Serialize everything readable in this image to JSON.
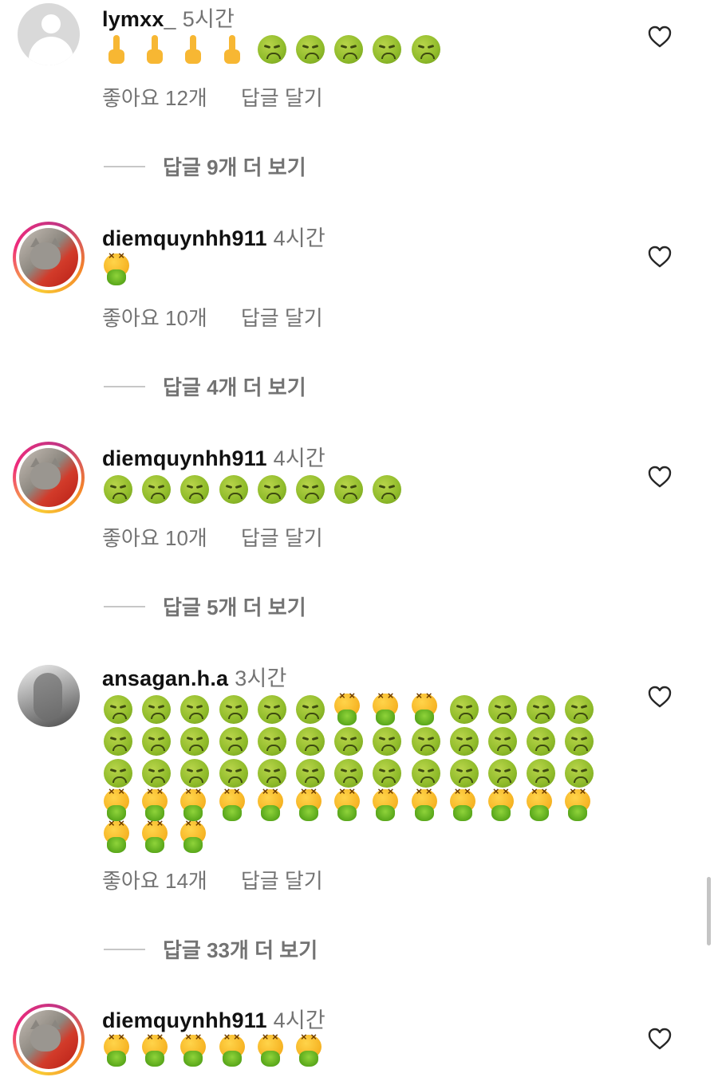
{
  "comments": [
    {
      "username": "lymxx_",
      "time": "5시간",
      "avatar": "default-avatar",
      "emoji_rows": [
        [
          "middle-finger",
          "middle-finger",
          "middle-finger",
          "middle-finger",
          "nauseated",
          "nauseated",
          "nauseated",
          "nauseated",
          "nauseated"
        ]
      ],
      "likes": "좋아요 12개",
      "reply": "답글 달기",
      "view_replies": "답글 9개 더 보기"
    },
    {
      "username": "diemquynhh911",
      "time": "4시간",
      "avatar": "cat-avatar",
      "emoji_rows": [
        [
          "vomiting"
        ]
      ],
      "likes": "좋아요 10개",
      "reply": "답글 달기",
      "view_replies": "답글 4개 더 보기"
    },
    {
      "username": "diemquynhh911",
      "time": "4시간",
      "avatar": "cat-avatar",
      "emoji_rows": [
        [
          "nauseated",
          "nauseated",
          "nauseated",
          "nauseated",
          "nauseated",
          "nauseated",
          "nauseated",
          "nauseated"
        ]
      ],
      "likes": "좋아요 10개",
      "reply": "답글 달기",
      "view_replies": "답글 5개 더 보기"
    },
    {
      "username": "ansagan.h.a",
      "time": "3시간",
      "avatar": "gray-avatar",
      "emoji_rows": [
        [
          "nauseated",
          "nauseated",
          "nauseated",
          "nauseated",
          "nauseated",
          "nauseated",
          "vomiting",
          "vomiting",
          "vomiting",
          "nauseated",
          "nauseated",
          "nauseated",
          "nauseated"
        ],
        [
          "nauseated",
          "nauseated",
          "nauseated",
          "nauseated",
          "nauseated",
          "nauseated",
          "nauseated",
          "nauseated",
          "nauseated",
          "nauseated",
          "nauseated",
          "nauseated",
          "nauseated"
        ],
        [
          "nauseated",
          "nauseated",
          "nauseated",
          "nauseated",
          "nauseated",
          "nauseated",
          "nauseated",
          "nauseated",
          "nauseated",
          "nauseated",
          "nauseated",
          "nauseated",
          "nauseated"
        ],
        [
          "vomiting",
          "vomiting",
          "vomiting",
          "vomiting",
          "vomiting",
          "vomiting",
          "vomiting",
          "vomiting",
          "vomiting",
          "vomiting",
          "vomiting",
          "vomiting",
          "vomiting"
        ],
        [
          "vomiting",
          "vomiting",
          "vomiting"
        ]
      ],
      "likes": "좋아요 14개",
      "reply": "답글 달기",
      "view_replies": "답글 33개 더 보기"
    },
    {
      "username": "diemquynhh911",
      "time": "4시간",
      "avatar": "cat-avatar",
      "emoji_rows": [
        [
          "vomiting",
          "vomiting",
          "vomiting",
          "vomiting",
          "vomiting",
          "vomiting"
        ]
      ],
      "likes": "",
      "reply": "",
      "view_replies": ""
    }
  ]
}
